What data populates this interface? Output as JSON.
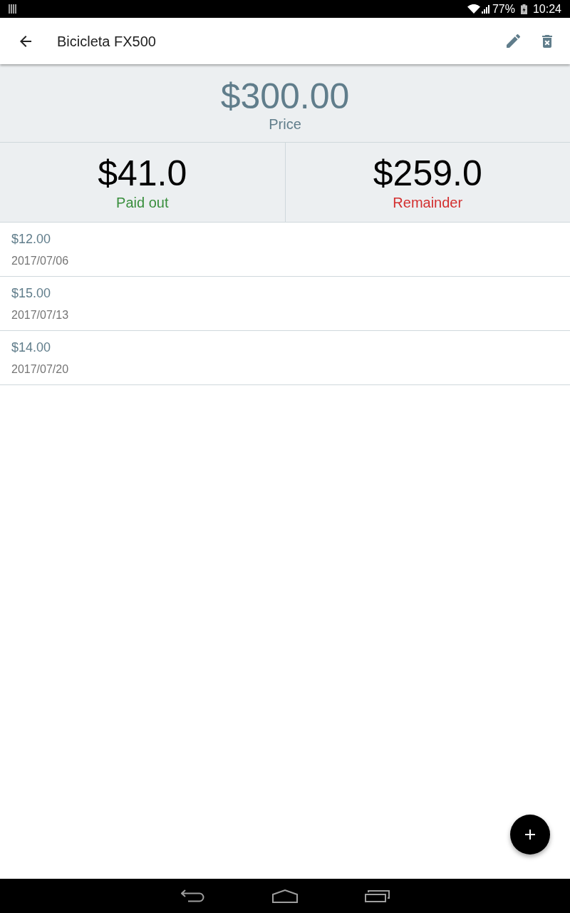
{
  "status_bar": {
    "battery": "77%",
    "time": "10:24"
  },
  "app_bar": {
    "title": "Bicicleta FX500"
  },
  "price": {
    "amount": "$300.00",
    "label": "Price"
  },
  "summary": [
    {
      "amount": "$41.0",
      "label": "Paid out",
      "color": "#388e3c"
    },
    {
      "amount": "$259.0",
      "label": "Remainder",
      "color": "#d32f2f"
    }
  ],
  "payments": [
    {
      "amount": "$12.00",
      "date": "2017/07/06"
    },
    {
      "amount": "$15.00",
      "date": "2017/07/13"
    },
    {
      "amount": "$14.00",
      "date": "2017/07/20"
    }
  ]
}
